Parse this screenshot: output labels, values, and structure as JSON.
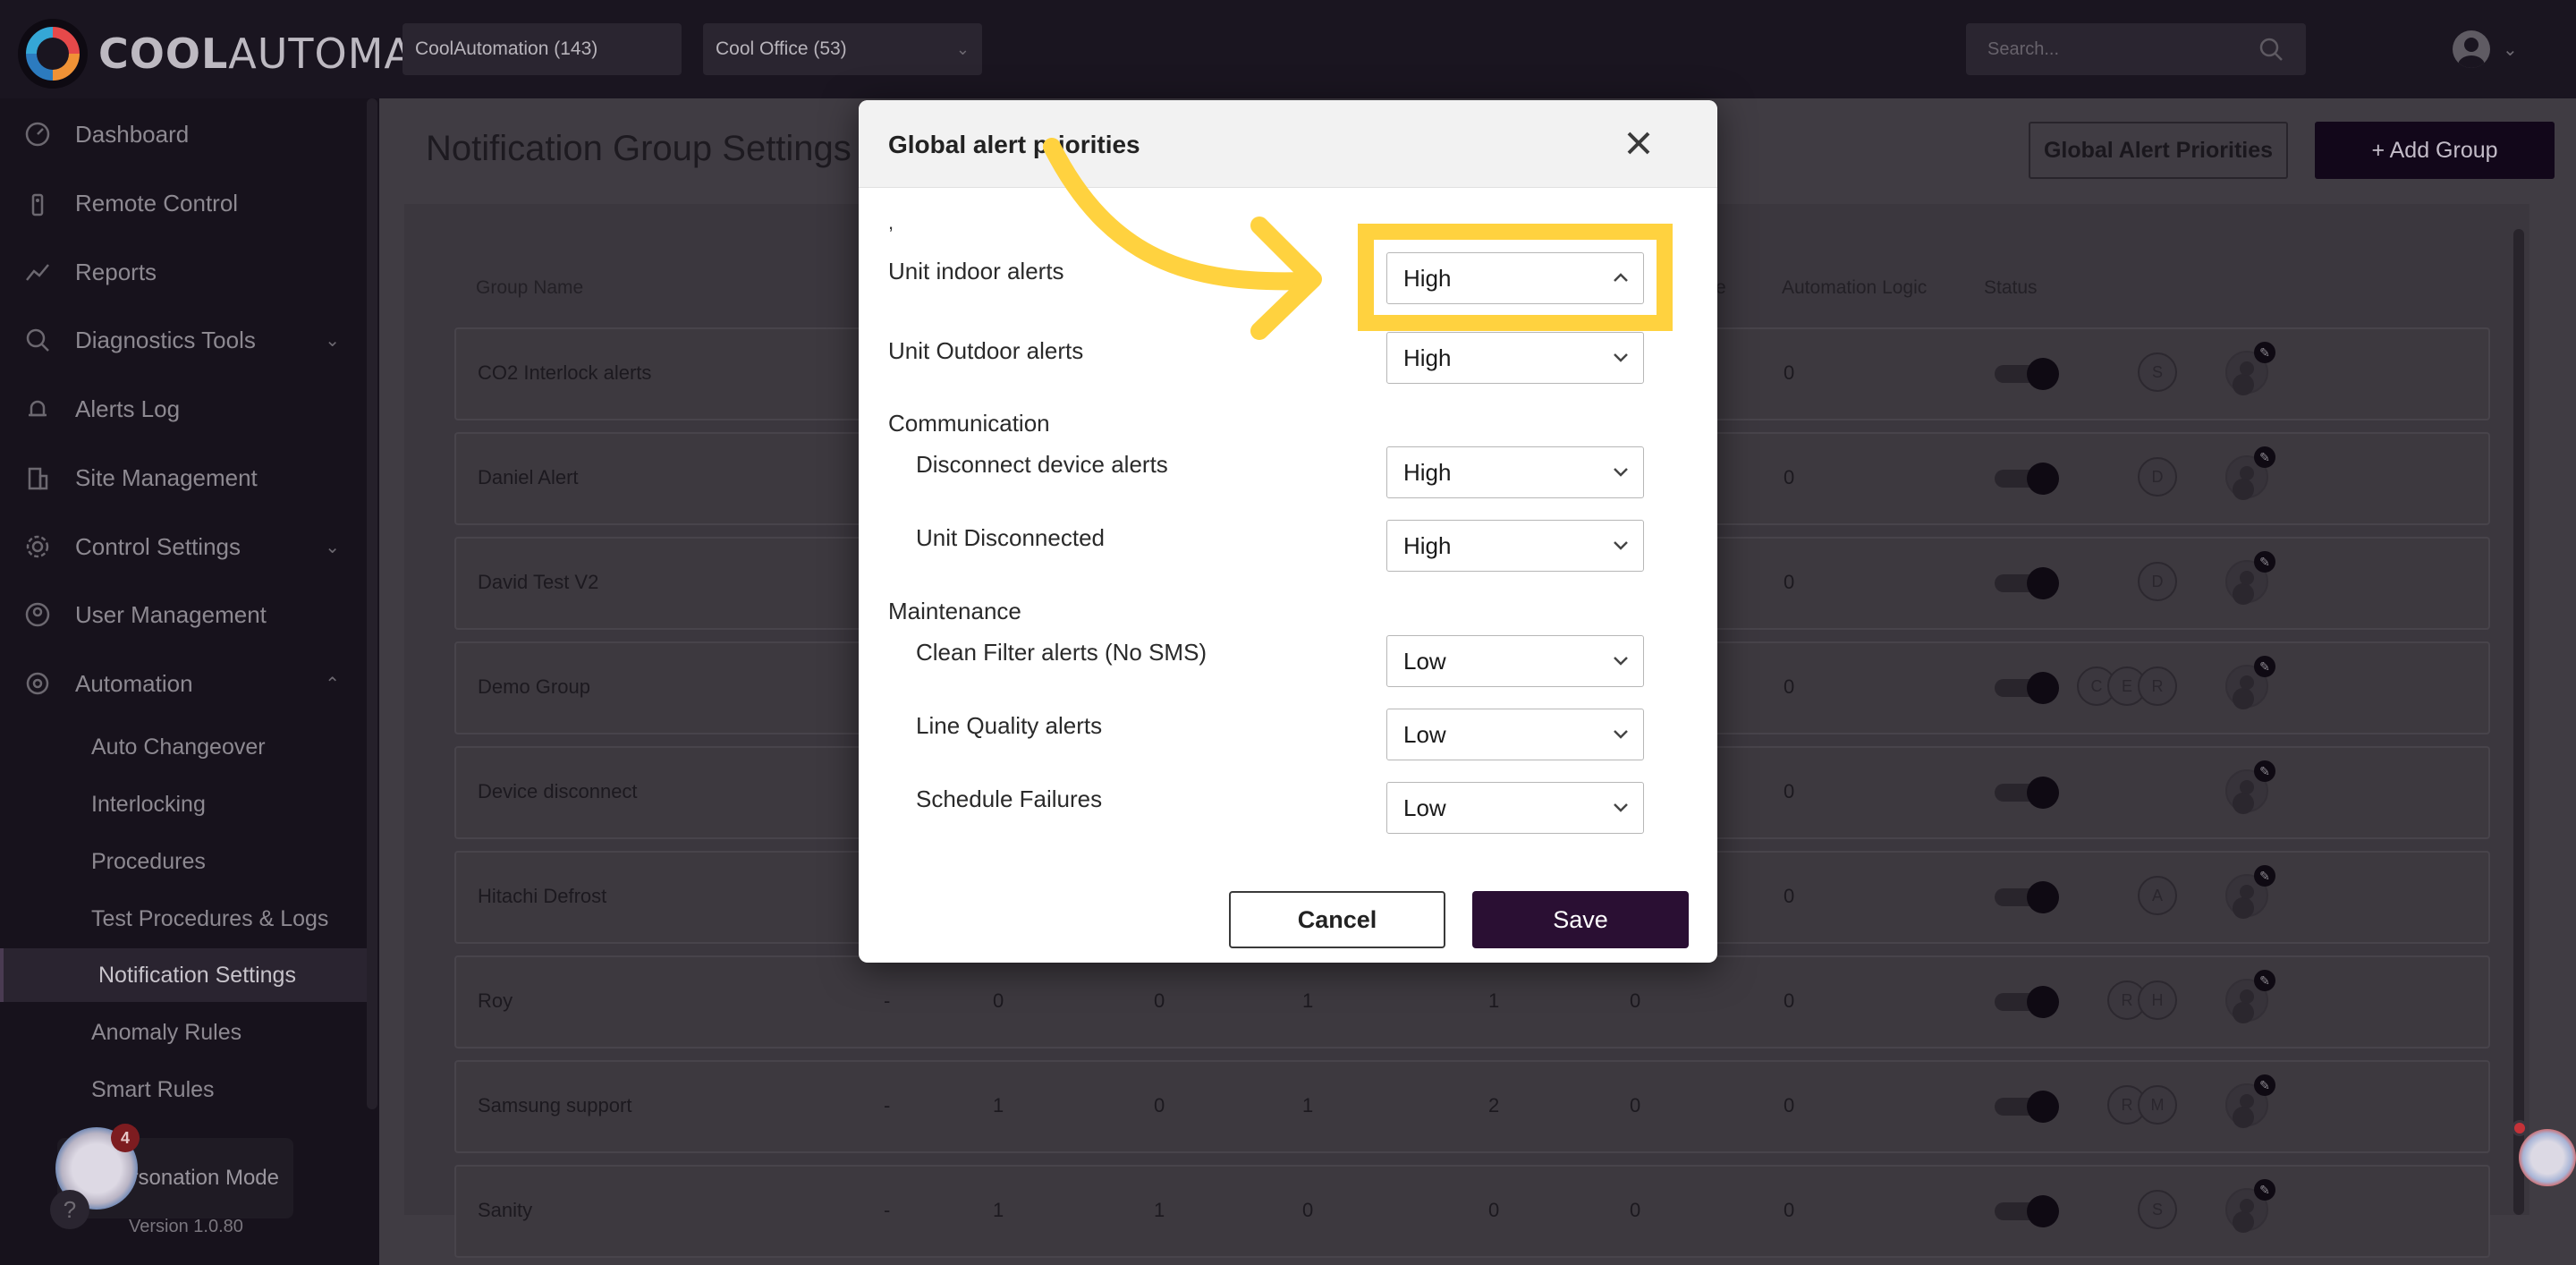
{
  "brand": {
    "name_bold": "COOL",
    "name_rest": "AUTOMATION"
  },
  "topbar": {
    "customer_select": "CoolAutomation (143)",
    "site_select": "Cool Office (53)",
    "search_placeholder": "Search..."
  },
  "sidebar": {
    "items": [
      {
        "label": "Dashboard",
        "icon": "dashboard-icon"
      },
      {
        "label": "Remote Control",
        "icon": "remote-icon"
      },
      {
        "label": "Reports",
        "icon": "chart-line-icon"
      },
      {
        "label": "Diagnostics Tools",
        "icon": "diagnostics-icon"
      },
      {
        "label": "Alerts Log",
        "icon": "bell-icon"
      },
      {
        "label": "Site Management",
        "icon": "building-icon"
      },
      {
        "label": "Control Settings",
        "icon": "gear-icon"
      },
      {
        "label": "User Management",
        "icon": "user-circle-icon"
      },
      {
        "label": "Automation",
        "icon": "automation-icon"
      }
    ],
    "sub_items": [
      "Auto Changeover",
      "Interlocking",
      "Procedures",
      "Test Procedures & Logs",
      "Notification Settings",
      "Anomaly Rules",
      "Smart Rules"
    ],
    "active_sub": "Notification Settings",
    "impersonation_label": "rsonation Mode",
    "badge_count": "4",
    "version": "Version 1.0.80"
  },
  "page": {
    "title": "Notification Group Settings",
    "global_button": "Global Alert Priorities",
    "add_button": "+ Add Group"
  },
  "table": {
    "headers": {
      "group_name": "Group Name",
      "partial": "e",
      "automation_logic": "Automation Logic",
      "status": "Status"
    },
    "rows": [
      {
        "name": "CO2 Interlock alerts",
        "nums": [],
        "auto": "0",
        "avatars": [
          "S"
        ]
      },
      {
        "name": "Daniel Alert",
        "nums": [],
        "auto": "0",
        "avatars": [
          "D"
        ]
      },
      {
        "name": "David Test V2",
        "nums": [],
        "auto": "0",
        "avatars": [
          "D"
        ]
      },
      {
        "name": "Demo Group",
        "nums": [],
        "auto": "0",
        "avatars": [
          "C",
          "E",
          "R"
        ]
      },
      {
        "name": "Device disconnect",
        "nums": [],
        "auto": "0",
        "avatars": []
      },
      {
        "name": "Hitachi Defrost",
        "nums": [],
        "auto": "0",
        "avatars": [
          "A"
        ]
      },
      {
        "name": "Roy",
        "nums": [
          "-",
          "0",
          "0",
          "1",
          "1",
          "0"
        ],
        "auto": "0",
        "avatars": [
          "R",
          "H"
        ]
      },
      {
        "name": "Samsung support",
        "nums": [
          "-",
          "1",
          "0",
          "1",
          "2",
          "0"
        ],
        "auto": "0",
        "avatars": [
          "R",
          "M"
        ]
      },
      {
        "name": "Sanity",
        "nums": [
          "-",
          "1",
          "1",
          "0",
          "0",
          "0"
        ],
        "auto": "0",
        "avatars": [
          "S"
        ]
      }
    ]
  },
  "modal": {
    "title": "Global alert priorities",
    "stray_mark": ",",
    "rows": [
      {
        "label": "Unit indoor alerts",
        "value": "High",
        "open": true,
        "indent": false
      },
      {
        "label": "Unit Outdoor alerts",
        "value": "High",
        "open": false,
        "indent": false
      },
      {
        "section": "Communication"
      },
      {
        "label": "Disconnect device alerts",
        "value": "High",
        "open": false,
        "indent": true
      },
      {
        "label": "Unit Disconnected",
        "value": "High",
        "open": false,
        "indent": true
      },
      {
        "section": "Maintenance"
      },
      {
        "label": "Clean Filter alerts (No SMS)",
        "value": "Low",
        "open": false,
        "indent": true
      },
      {
        "label": "Line Quality alerts",
        "value": "Low",
        "open": false,
        "indent": true
      },
      {
        "label": "Schedule Failures",
        "value": "Low",
        "open": false,
        "indent": true
      }
    ],
    "cancel_label": "Cancel",
    "save_label": "Save"
  },
  "colors": {
    "highlight": "#ffd23f",
    "save_button": "#2a0f33",
    "add_button": "#12071a"
  }
}
